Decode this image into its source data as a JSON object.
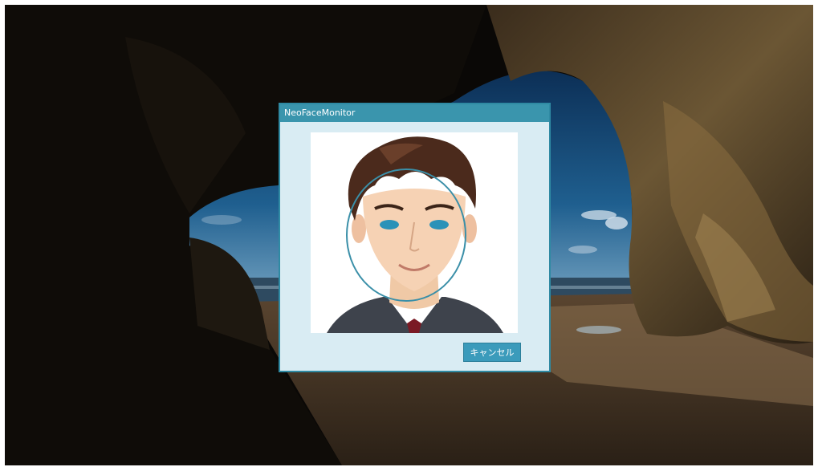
{
  "window": {
    "title": "NeoFaceMonitor"
  },
  "dialog": {
    "cancel_label": "キャンセル"
  },
  "colors": {
    "titlebar": "#3a95ad",
    "dialog_bg": "#d9ecf3",
    "button": "#3b9bbb",
    "face_guide": "#3a8fa8"
  },
  "icons": {
    "face_guide": "face-guide-circle-icon",
    "eye_markers": "eye-marker-icon"
  }
}
